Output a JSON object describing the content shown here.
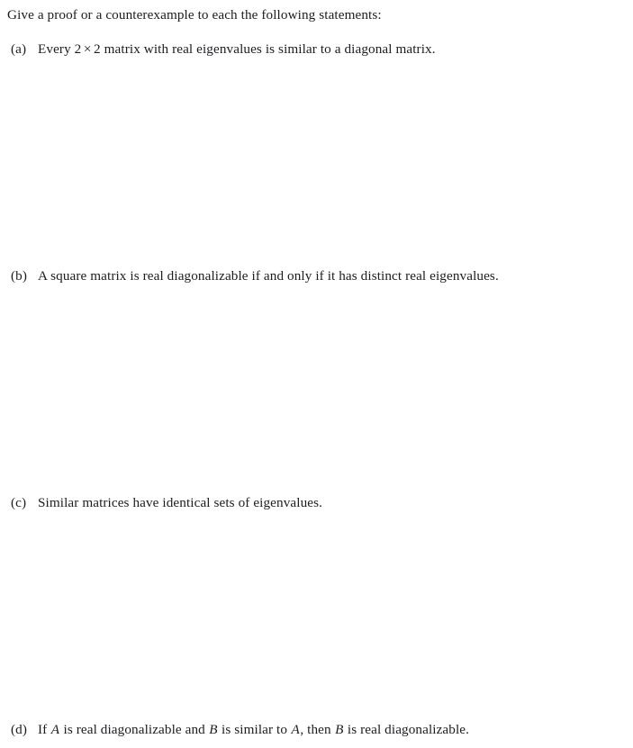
{
  "document": {
    "prompt": "Give a proof or a counterexample to each the following statements:",
    "items": [
      {
        "label": "(a)",
        "text_before": "Every ",
        "math_lhs": "2",
        "math_op": "×",
        "math_rhs": "2",
        "text_after": " matrix with real eigenvalues is similar to a diagonal matrix.",
        "full_text": "Every 2 × 2 matrix with real eigenvalues is similar to a diagonal matrix."
      },
      {
        "label": "(b)",
        "full_text": "A square matrix is real diagonalizable if and only if it has distinct real eigenvalues."
      },
      {
        "label": "(c)",
        "full_text": "Similar matrices have identical sets of eigenvalues."
      },
      {
        "label": "(d)",
        "seg1": "If ",
        "var1": "A",
        "seg2": " is real diagonalizable and ",
        "var2": "B",
        "seg3": " is similar to ",
        "var3": "A",
        "seg4": ", then ",
        "var4": "B",
        "seg5": " is real diagonalizable.",
        "full_text": "If A is real diagonalizable and B is similar to A, then B is real diagonalizable."
      }
    ]
  },
  "colors": {
    "page_background": "#ffffff",
    "text": "#1c1c22"
  }
}
